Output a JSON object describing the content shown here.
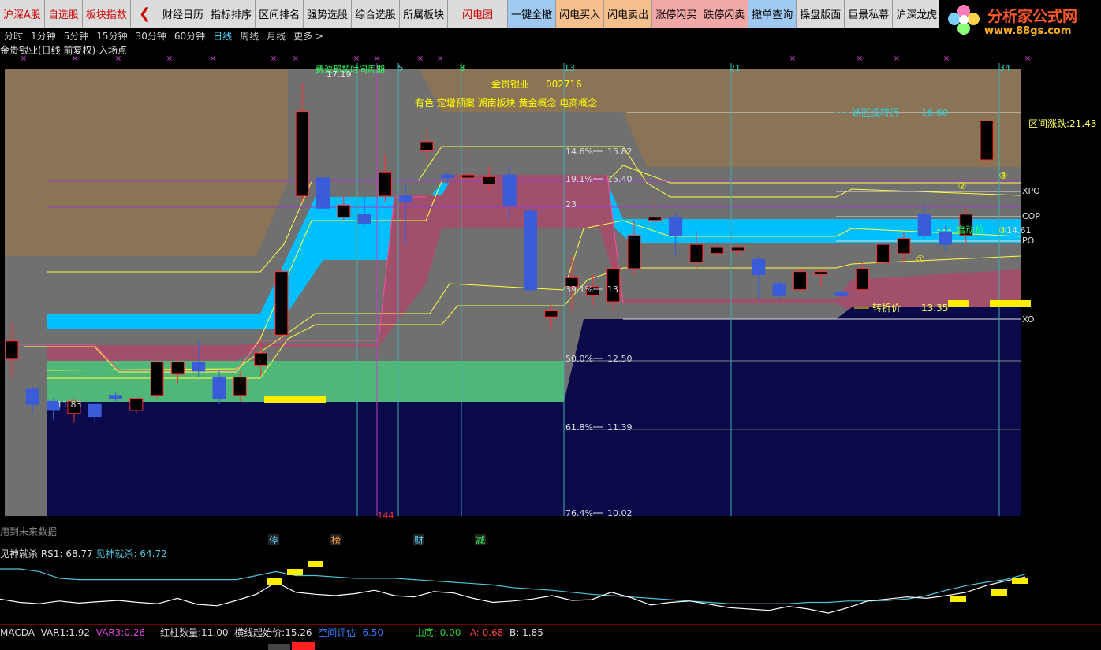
{
  "toolbar": {
    "items": [
      "沪深A股",
      "自选股",
      "板块指数",
      "财经日历",
      "指标排序",
      "区间排名",
      "强势选股",
      "综合选股",
      "所属板块",
      "闪电图",
      "一键全撤",
      "闪电买入",
      "闪电卖出",
      "涨停闪买",
      "跌停闪卖",
      "撤单查询",
      "操盘版面",
      "巨景私幕",
      "沪深龙虎"
    ]
  },
  "logo": {
    "title": "分析家公式网",
    "url": "www.88gs.com"
  },
  "periods": {
    "items": [
      "分时",
      "1分钟",
      "5分钟",
      "15分钟",
      "30分钟",
      "60分钟",
      "日线",
      "周线",
      "月线",
      "更多 >"
    ],
    "active": "日线"
  },
  "stock_title": "金贵银业(日线 前复权) 入场点",
  "info": {
    "name": "金贵银业",
    "code": "002716",
    "concepts": "有色 定增预案 湖南板块 黄金概念 电商概念"
  },
  "top_labels": {
    "cycle": "费波那契时间周期",
    "c5": "5",
    "c8": "8",
    "c13": "13",
    "c21": "21",
    "c34": "34",
    "high": "17.19",
    "low144": "144"
  },
  "fib": [
    {
      "pct": "14.6%",
      "val": "15.82"
    },
    {
      "pct": "19.1%",
      "val": "15.40"
    },
    {
      "pct": "23",
      "val": ""
    },
    {
      "pct": "39.1%",
      "val": "13"
    },
    {
      "pct": "50.0%",
      "val": "12.50"
    },
    {
      "pct": "61.8%",
      "val": "11.39"
    },
    {
      "pct": "76.4%",
      "val": "10.02"
    }
  ],
  "annotations": {
    "yao_label": "妖区或转折",
    "yao_val": "16.60",
    "range_rise": "区间涨跌:21.43",
    "start_label": "启动价",
    "start_val": "14.61",
    "turn_label": "转折价",
    "turn_val": "13.35",
    "low_val": "11.83",
    "xpo": "XPO",
    "cop": "COP",
    "po": "PO",
    "xo": "XO",
    "c1": "①",
    "c2": "②",
    "c3": "③"
  },
  "note": "用到未来数据",
  "events": [
    "停",
    "榜",
    "财",
    "减"
  ],
  "rs": {
    "name": "见神就杀",
    "rs1_label": "RS1:",
    "rs1": "68.77",
    "rs2_label": "见神就杀:",
    "rs2": "64.72"
  },
  "macd": {
    "name": "MACDA",
    "var1_label": "VAR1:",
    "var1": "1.92",
    "var3_label": "VAR3:",
    "var3": "0.26",
    "red_count_label": "红柱数量:",
    "red_count": "11.00",
    "start_label": "横线起始价:",
    "start_price": "15.26",
    "space_label": "空间评估",
    "space_val": "-6.50",
    "bottom_label": "山底:",
    "bottom_val": "0.00",
    "a_label": "A:",
    "a_val": "0.68",
    "b_label": "B:",
    "b_val": "1.85"
  },
  "colors": {
    "up": "#ff3030",
    "down": "#3355ff",
    "yellow": "#ffff00",
    "cyan": "#00bfff",
    "navy": "#0a0a4a",
    "tan": "#8b7355",
    "mauve": "#a0506a",
    "green": "#4fb878",
    "grey": "#707070"
  },
  "candles": [
    {
      "o": 12.6,
      "c": 12.9,
      "h": 13.2,
      "l": 12.3
    },
    {
      "o": 12.1,
      "c": 11.85,
      "h": 12.15,
      "l": 11.7
    },
    {
      "o": 11.9,
      "c": 11.75,
      "h": 11.95,
      "l": 11.6
    },
    {
      "o": 11.7,
      "c": 11.9,
      "h": 11.95,
      "l": 11.55
    },
    {
      "o": 11.85,
      "c": 11.65,
      "h": 11.9,
      "l": 11.55
    },
    {
      "o": 12.0,
      "c": 11.95,
      "h": 12.05,
      "l": 11.9
    },
    {
      "o": 11.75,
      "c": 11.95,
      "h": 12.0,
      "l": 11.7
    },
    {
      "o": 12.0,
      "c": 12.55,
      "h": 12.6,
      "l": 11.95
    },
    {
      "o": 12.35,
      "c": 12.55,
      "h": 12.6,
      "l": 12.2
    },
    {
      "o": 12.55,
      "c": 12.4,
      "h": 12.9,
      "l": 12.3
    },
    {
      "o": 12.3,
      "c": 11.95,
      "h": 12.4,
      "l": 11.85
    },
    {
      "o": 12.0,
      "c": 12.3,
      "h": 12.4,
      "l": 11.9
    },
    {
      "o": 12.5,
      "c": 12.7,
      "h": 12.9,
      "l": 12.3
    },
    {
      "o": 13.0,
      "c": 14.05,
      "h": 14.1,
      "l": 12.9
    },
    {
      "o": 15.3,
      "c": 16.7,
      "h": 17.19,
      "l": 15.2
    },
    {
      "o": 15.6,
      "c": 15.1,
      "h": 15.9,
      "l": 15.0
    },
    {
      "o": 14.95,
      "c": 15.15,
      "h": 15.3,
      "l": 14.9
    },
    {
      "o": 15.0,
      "c": 14.85,
      "h": 15.3,
      "l": 14.8
    },
    {
      "o": 15.3,
      "c": 15.7,
      "h": 16.0,
      "l": 15.2
    },
    {
      "o": 15.3,
      "c": 15.2,
      "h": 15.5,
      "l": 14.5
    },
    {
      "o": 16.05,
      "c": 16.2,
      "h": 16.4,
      "l": 15.9
    },
    {
      "o": 15.65,
      "c": 15.6,
      "h": 15.7,
      "l": 15.5
    },
    {
      "o": 15.6,
      "c": 15.65,
      "h": 16.3,
      "l": 15.5
    },
    {
      "o": 15.5,
      "c": 15.62,
      "h": 15.8,
      "l": 15.4
    },
    {
      "o": 15.65,
      "c": 15.15,
      "h": 15.8,
      "l": 14.9
    },
    {
      "o": 15.05,
      "c": 13.75,
      "h": 15.1,
      "l": 13.7
    },
    {
      "o": 13.3,
      "c": 13.4,
      "h": 13.5,
      "l": 13.1
    },
    {
      "o": 13.8,
      "c": 13.95,
      "h": 14.3,
      "l": 13.4
    },
    {
      "o": 13.65,
      "c": 13.8,
      "h": 14.0,
      "l": 13.5
    },
    {
      "o": 13.55,
      "c": 14.1,
      "h": 14.2,
      "l": 13.4
    },
    {
      "o": 14.1,
      "c": 14.65,
      "h": 14.9,
      "l": 14.0
    },
    {
      "o": 14.9,
      "c": 14.95,
      "h": 15.3,
      "l": 14.8
    },
    {
      "o": 14.95,
      "c": 14.65,
      "h": 15.05,
      "l": 14.3
    },
    {
      "o": 14.2,
      "c": 14.5,
      "h": 14.7,
      "l": 14.1
    },
    {
      "o": 14.35,
      "c": 14.45,
      "h": 14.5,
      "l": 14.3
    },
    {
      "o": 14.4,
      "c": 14.45,
      "h": 14.5,
      "l": 14.3
    },
    {
      "o": 14.25,
      "c": 14.0,
      "h": 14.3,
      "l": 13.6
    },
    {
      "o": 13.85,
      "c": 13.65,
      "h": 13.9,
      "l": 13.6
    },
    {
      "o": 13.75,
      "c": 14.05,
      "h": 14.1,
      "l": 13.7
    },
    {
      "o": 14.0,
      "c": 14.05,
      "h": 14.1,
      "l": 13.8
    },
    {
      "o": 13.7,
      "c": 13.65,
      "h": 13.75,
      "l": 13.6
    },
    {
      "o": 13.75,
      "c": 14.1,
      "h": 14.2,
      "l": 13.7
    },
    {
      "o": 14.2,
      "c": 14.5,
      "h": 14.6,
      "l": 14.1
    },
    {
      "o": 14.35,
      "c": 14.6,
      "h": 14.7,
      "l": 14.2
    },
    {
      "o": 15.0,
      "c": 14.65,
      "h": 15.2,
      "l": 14.6
    },
    {
      "o": 14.7,
      "c": 14.5,
      "h": 14.8,
      "l": 14.4
    },
    {
      "o": 14.65,
      "c": 15.0,
      "h": 15.1,
      "l": 14.5
    },
    {
      "o": 15.9,
      "c": 16.55,
      "h": 16.6,
      "l": 15.8
    }
  ],
  "rs_series": {
    "rs1": [
      35,
      30,
      28,
      32,
      29,
      31,
      33,
      30,
      28,
      36,
      27,
      25,
      33,
      42,
      60,
      45,
      42,
      40,
      43,
      48,
      40,
      38,
      46,
      44,
      36,
      30,
      32,
      35,
      40,
      33,
      34,
      45,
      37,
      26,
      30,
      32,
      27,
      22,
      20,
      18,
      24,
      20,
      14,
      22,
      32,
      35,
      38,
      36,
      40,
      45,
      55,
      62,
      68
    ],
    "rs2": [
      80,
      80,
      76,
      66,
      64,
      64,
      64,
      64,
      64,
      64,
      64,
      64,
      64,
      70,
      76,
      70,
      70,
      68,
      66,
      66,
      66,
      64,
      62,
      60,
      58,
      56,
      52,
      50,
      48,
      45,
      42,
      40,
      38,
      36,
      34,
      32,
      30,
      28,
      28,
      28,
      28,
      30,
      30,
      32,
      32,
      33,
      35,
      40,
      48,
      55,
      60,
      64,
      72
    ]
  }
}
